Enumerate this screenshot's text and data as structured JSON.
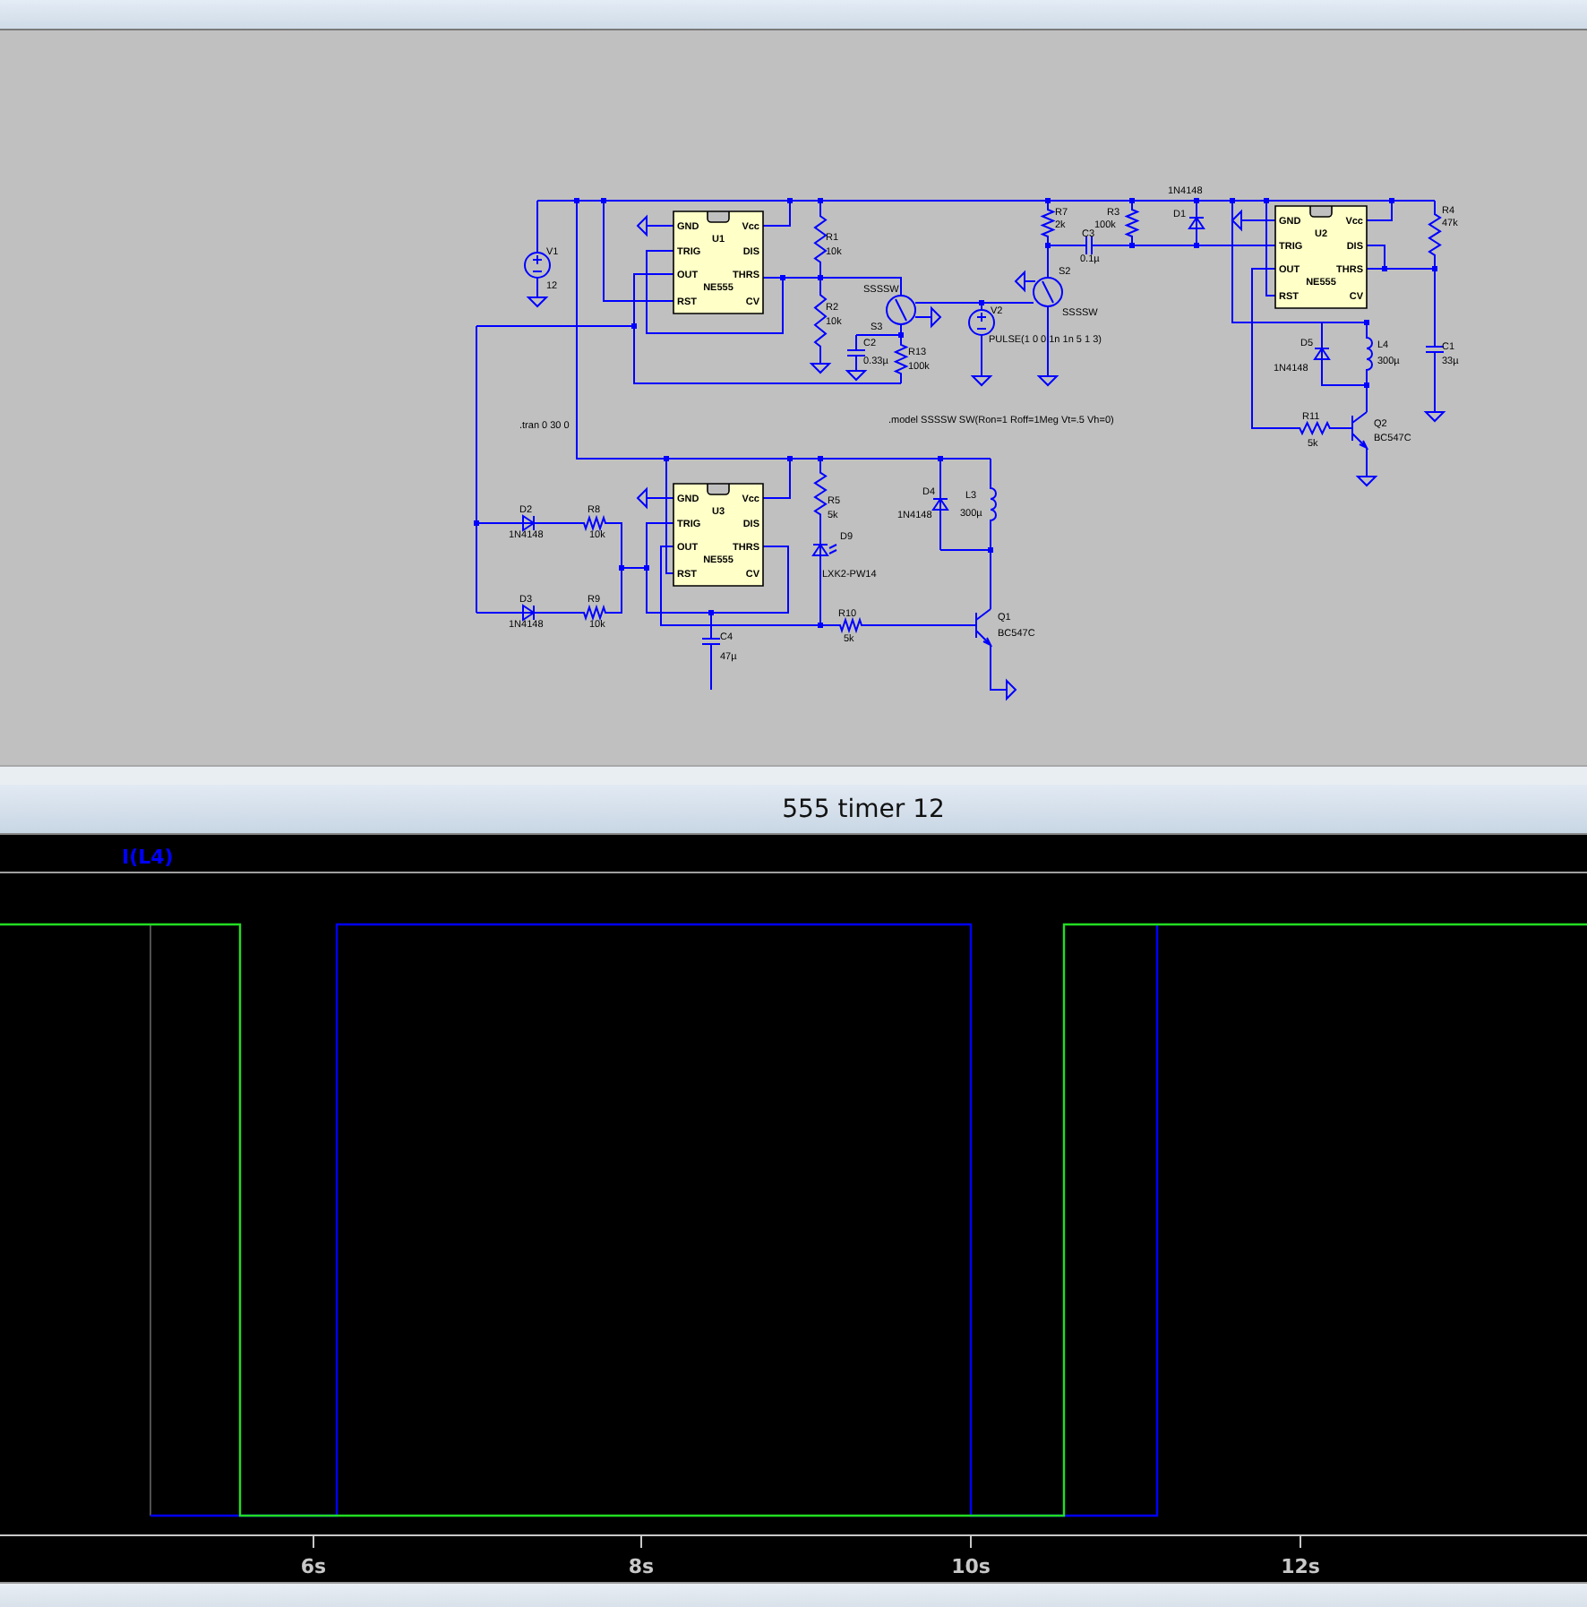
{
  "schematic": {
    "chips": [
      {
        "ref": "U1",
        "part": "NE555",
        "pins": [
          "GND",
          "TRIG",
          "OUT",
          "RST",
          "Vcc",
          "DIS",
          "THRS",
          "CV"
        ]
      },
      {
        "ref": "U2",
        "part": "NE555",
        "pins": [
          "GND",
          "TRIG",
          "OUT",
          "RST",
          "Vcc",
          "DIS",
          "THRS",
          "CV"
        ]
      },
      {
        "ref": "U3",
        "part": "NE555",
        "pins": [
          "GND",
          "TRIG",
          "OUT",
          "RST",
          "Vcc",
          "DIS",
          "THRS",
          "CV"
        ]
      }
    ],
    "components": [
      {
        "kind": "resistor",
        "ref": "R7",
        "value": "2k"
      },
      {
        "kind": "resistor",
        "ref": "R3",
        "value": "100k"
      },
      {
        "kind": "diode",
        "ref": "D1",
        "value": "1N4148"
      },
      {
        "kind": "resistor",
        "ref": "R4",
        "value": "47k"
      },
      {
        "kind": "source",
        "ref": "V1",
        "value": "12"
      },
      {
        "kind": "resistor",
        "ref": "R1",
        "value": "10k"
      },
      {
        "kind": "capacitor",
        "ref": "C3",
        "value": "0.1µ"
      },
      {
        "kind": "resistor",
        "ref": "R2",
        "value": "10k"
      },
      {
        "kind": "switch",
        "ref": "S3",
        "value": "SSSSW"
      },
      {
        "kind": "switch",
        "ref": "S2",
        "value": "SSSSW"
      },
      {
        "kind": "capacitor",
        "ref": "C2",
        "value": "0.33µ"
      },
      {
        "kind": "resistor",
        "ref": "R13",
        "value": "100k"
      },
      {
        "kind": "source",
        "ref": "V2",
        "value": "PULSE(1 0 0 1n 1n 5 1 3)"
      },
      {
        "kind": "diode",
        "ref": "D5",
        "value": "1N4148"
      },
      {
        "kind": "inductor",
        "ref": "L4",
        "value": "300µ"
      },
      {
        "kind": "capacitor",
        "ref": "C1",
        "value": "33µ"
      },
      {
        "kind": "resistor",
        "ref": "R11",
        "value": "5k"
      },
      {
        "kind": "transistor",
        "ref": "Q2",
        "value": "BC547C"
      },
      {
        "kind": "diode",
        "ref": "D2",
        "value": "1N4148"
      },
      {
        "kind": "resistor",
        "ref": "R8",
        "value": "10k"
      },
      {
        "kind": "resistor",
        "ref": "R5",
        "value": "5k"
      },
      {
        "kind": "diode",
        "ref": "D4",
        "value": "1N4148"
      },
      {
        "kind": "inductor",
        "ref": "L3",
        "value": "300µ"
      },
      {
        "kind": "led",
        "ref": "D9",
        "value": "LXK2-PW14"
      },
      {
        "kind": "diode",
        "ref": "D3",
        "value": "1N4148"
      },
      {
        "kind": "resistor",
        "ref": "R9",
        "value": "10k"
      },
      {
        "kind": "capacitor",
        "ref": "C4",
        "value": "47µ"
      },
      {
        "kind": "resistor",
        "ref": "R10",
        "value": "5k"
      },
      {
        "kind": "transistor",
        "ref": "Q1",
        "value": "BC547C"
      }
    ],
    "directives": [
      ".tran 0 30 0",
      ".model SSSSW SW(Ron=1 Roff=1Meg Vt=.5 Vh=0)"
    ]
  },
  "plot": {
    "title": "555 timer 12",
    "trace_label": "I(L4)",
    "x_tick_labels": [
      "6s",
      "8s",
      "10s",
      "12s"
    ]
  }
}
